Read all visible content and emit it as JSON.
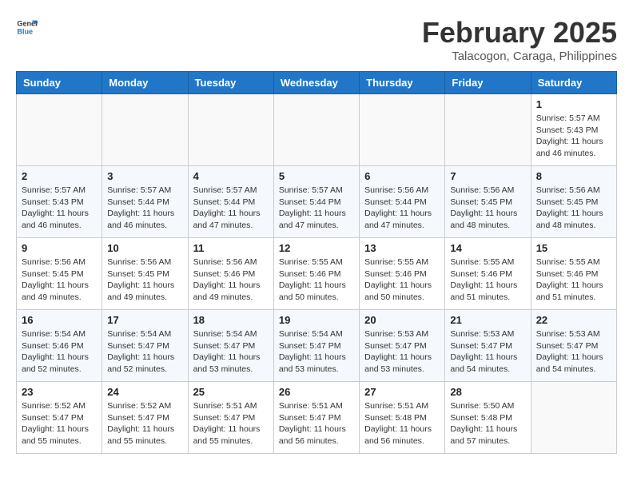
{
  "header": {
    "logo_line1": "General",
    "logo_line2": "Blue",
    "month": "February 2025",
    "location": "Talacogon, Caraga, Philippines"
  },
  "weekdays": [
    "Sunday",
    "Monday",
    "Tuesday",
    "Wednesday",
    "Thursday",
    "Friday",
    "Saturday"
  ],
  "weeks": [
    [
      {
        "day": "",
        "info": ""
      },
      {
        "day": "",
        "info": ""
      },
      {
        "day": "",
        "info": ""
      },
      {
        "day": "",
        "info": ""
      },
      {
        "day": "",
        "info": ""
      },
      {
        "day": "",
        "info": ""
      },
      {
        "day": "1",
        "info": "Sunrise: 5:57 AM\nSunset: 5:43 PM\nDaylight: 11 hours\nand 46 minutes."
      }
    ],
    [
      {
        "day": "2",
        "info": "Sunrise: 5:57 AM\nSunset: 5:43 PM\nDaylight: 11 hours\nand 46 minutes."
      },
      {
        "day": "3",
        "info": "Sunrise: 5:57 AM\nSunset: 5:44 PM\nDaylight: 11 hours\nand 46 minutes."
      },
      {
        "day": "4",
        "info": "Sunrise: 5:57 AM\nSunset: 5:44 PM\nDaylight: 11 hours\nand 47 minutes."
      },
      {
        "day": "5",
        "info": "Sunrise: 5:57 AM\nSunset: 5:44 PM\nDaylight: 11 hours\nand 47 minutes."
      },
      {
        "day": "6",
        "info": "Sunrise: 5:56 AM\nSunset: 5:44 PM\nDaylight: 11 hours\nand 47 minutes."
      },
      {
        "day": "7",
        "info": "Sunrise: 5:56 AM\nSunset: 5:45 PM\nDaylight: 11 hours\nand 48 minutes."
      },
      {
        "day": "8",
        "info": "Sunrise: 5:56 AM\nSunset: 5:45 PM\nDaylight: 11 hours\nand 48 minutes."
      }
    ],
    [
      {
        "day": "9",
        "info": "Sunrise: 5:56 AM\nSunset: 5:45 PM\nDaylight: 11 hours\nand 49 minutes."
      },
      {
        "day": "10",
        "info": "Sunrise: 5:56 AM\nSunset: 5:45 PM\nDaylight: 11 hours\nand 49 minutes."
      },
      {
        "day": "11",
        "info": "Sunrise: 5:56 AM\nSunset: 5:46 PM\nDaylight: 11 hours\nand 49 minutes."
      },
      {
        "day": "12",
        "info": "Sunrise: 5:55 AM\nSunset: 5:46 PM\nDaylight: 11 hours\nand 50 minutes."
      },
      {
        "day": "13",
        "info": "Sunrise: 5:55 AM\nSunset: 5:46 PM\nDaylight: 11 hours\nand 50 minutes."
      },
      {
        "day": "14",
        "info": "Sunrise: 5:55 AM\nSunset: 5:46 PM\nDaylight: 11 hours\nand 51 minutes."
      },
      {
        "day": "15",
        "info": "Sunrise: 5:55 AM\nSunset: 5:46 PM\nDaylight: 11 hours\nand 51 minutes."
      }
    ],
    [
      {
        "day": "16",
        "info": "Sunrise: 5:54 AM\nSunset: 5:46 PM\nDaylight: 11 hours\nand 52 minutes."
      },
      {
        "day": "17",
        "info": "Sunrise: 5:54 AM\nSunset: 5:47 PM\nDaylight: 11 hours\nand 52 minutes."
      },
      {
        "day": "18",
        "info": "Sunrise: 5:54 AM\nSunset: 5:47 PM\nDaylight: 11 hours\nand 53 minutes."
      },
      {
        "day": "19",
        "info": "Sunrise: 5:54 AM\nSunset: 5:47 PM\nDaylight: 11 hours\nand 53 minutes."
      },
      {
        "day": "20",
        "info": "Sunrise: 5:53 AM\nSunset: 5:47 PM\nDaylight: 11 hours\nand 53 minutes."
      },
      {
        "day": "21",
        "info": "Sunrise: 5:53 AM\nSunset: 5:47 PM\nDaylight: 11 hours\nand 54 minutes."
      },
      {
        "day": "22",
        "info": "Sunrise: 5:53 AM\nSunset: 5:47 PM\nDaylight: 11 hours\nand 54 minutes."
      }
    ],
    [
      {
        "day": "23",
        "info": "Sunrise: 5:52 AM\nSunset: 5:47 PM\nDaylight: 11 hours\nand 55 minutes."
      },
      {
        "day": "24",
        "info": "Sunrise: 5:52 AM\nSunset: 5:47 PM\nDaylight: 11 hours\nand 55 minutes."
      },
      {
        "day": "25",
        "info": "Sunrise: 5:51 AM\nSunset: 5:47 PM\nDaylight: 11 hours\nand 55 minutes."
      },
      {
        "day": "26",
        "info": "Sunrise: 5:51 AM\nSunset: 5:47 PM\nDaylight: 11 hours\nand 56 minutes."
      },
      {
        "day": "27",
        "info": "Sunrise: 5:51 AM\nSunset: 5:48 PM\nDaylight: 11 hours\nand 56 minutes."
      },
      {
        "day": "28",
        "info": "Sunrise: 5:50 AM\nSunset: 5:48 PM\nDaylight: 11 hours\nand 57 minutes."
      },
      {
        "day": "",
        "info": ""
      }
    ]
  ]
}
